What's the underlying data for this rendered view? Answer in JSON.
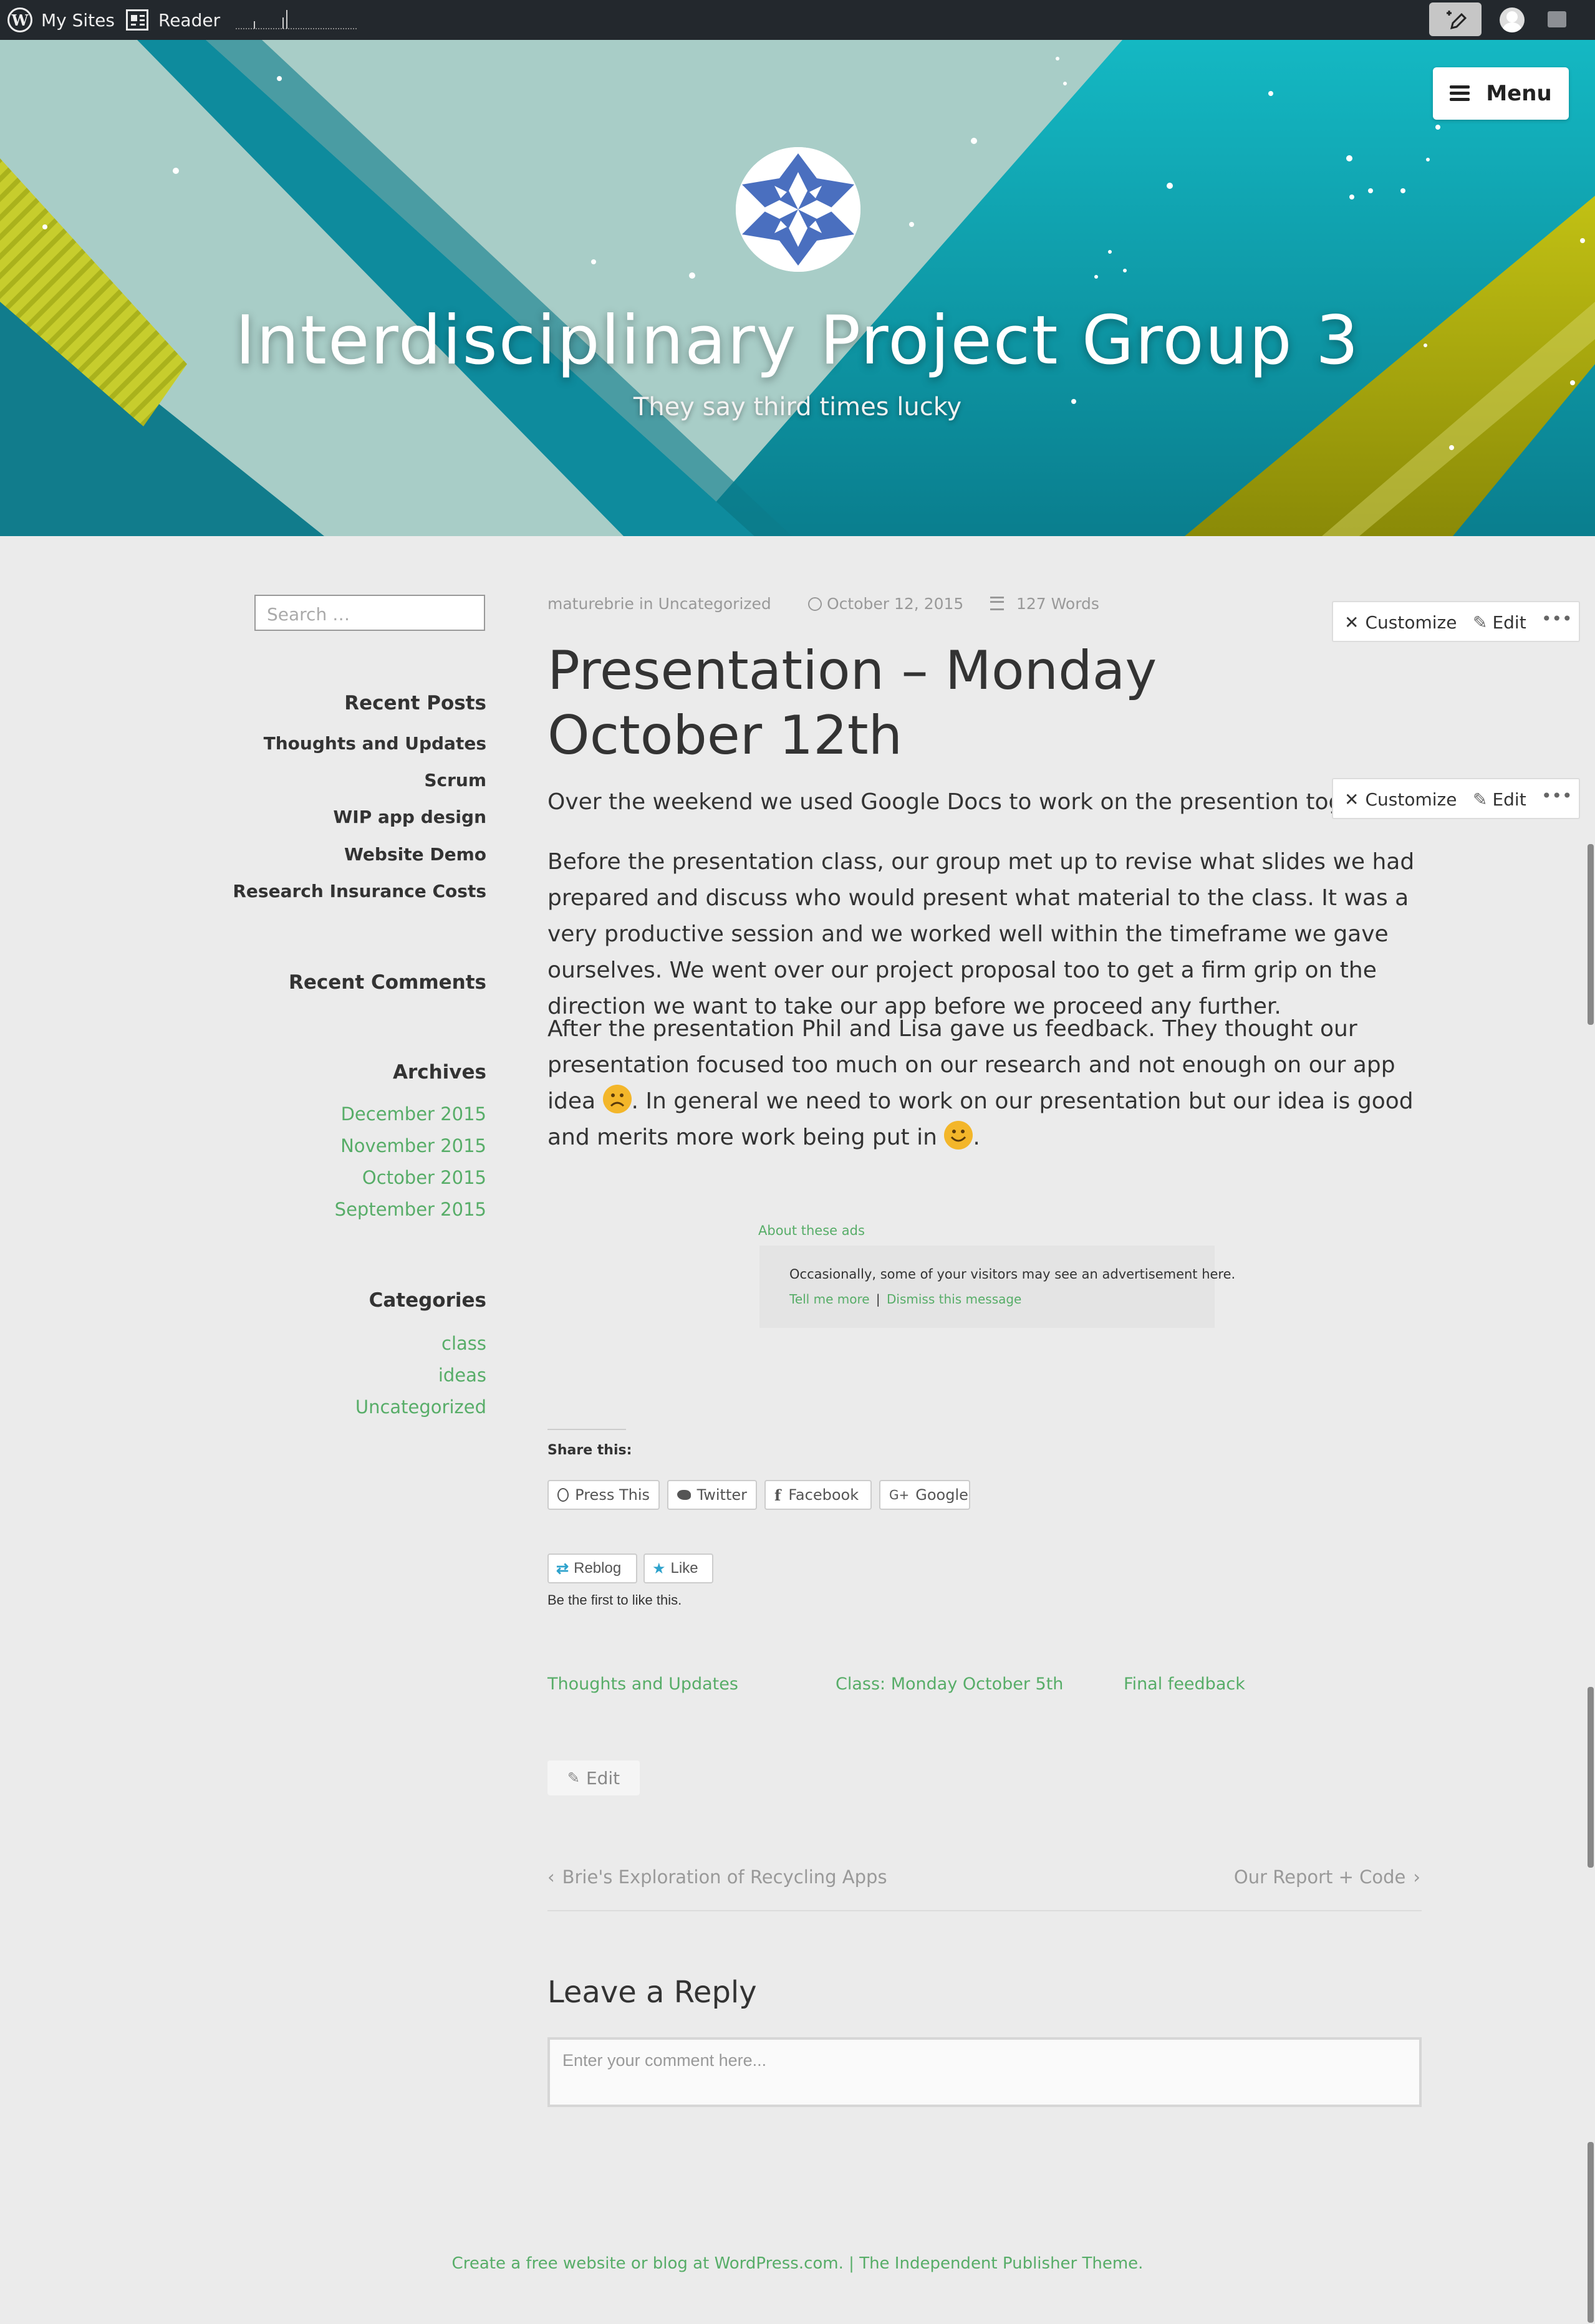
{
  "adminbar": {
    "my_sites": "My Sites",
    "reader": "Reader"
  },
  "header": {
    "title": "Interdisciplinary Project Group 3",
    "tagline": "They say third times lucky",
    "menu_label": "Menu"
  },
  "sidebar": {
    "search_placeholder": "Search …",
    "recent_posts_title": "Recent Posts",
    "recent_posts": [
      "Thoughts and Updates",
      "Scrum",
      "WIP app design",
      "Website Demo",
      "Research Insurance Costs"
    ],
    "recent_comments_title": "Recent Comments",
    "archives_title": "Archives",
    "archives": [
      "December 2015",
      "November 2015",
      "October 2015",
      "September 2015"
    ],
    "categories_title": "Categories",
    "categories": [
      "class",
      "ideas",
      "Uncategorized"
    ]
  },
  "post": {
    "author": "maturebrie",
    "in_word": "in",
    "category": "Uncategorized",
    "date": "October 12, 2015",
    "word_count": "127 Words",
    "title": "Presentation – Monday October 12th",
    "paragraph1": "Over the weekend we used Google Docs to work on the presention together.",
    "paragraph2": "Before the presentation class, our group met up to revise what slides we had prepared and discuss who would present what material to the class. It was a very productive session and we worked well within the timeframe we gave ourselves. We went over our project proposal too to get a firm grip on the direction we want to take our app before we proceed any further.",
    "paragraph3_a": "After the presentation Phil and Lisa gave us feedback. They thought our presentation focused too much on our research and not enough on our app idea ",
    "paragraph3_b": ". In general we need to work on our presentation but our idea is good and merits more work being put in ",
    "paragraph3_c": "."
  },
  "toolbar": {
    "customize": "Customize",
    "edit": "Edit",
    "more": "•••"
  },
  "ads": {
    "about": "About these ads",
    "notice": "Occasionally, some of your visitors may see an advertisement here.",
    "tell_more": "Tell me more",
    "separator": "|",
    "dismiss": "Dismiss this message"
  },
  "share": {
    "title": "Share this:",
    "press_this": "Press This",
    "twitter": "Twitter",
    "facebook": "Facebook",
    "google": "Google"
  },
  "likes": {
    "reblog": "Reblog",
    "like": "Like",
    "note": "Be the first to like this."
  },
  "related": [
    "Thoughts and Updates",
    "Class: Monday October 5th",
    "Final feedback"
  ],
  "edit_label": "Edit",
  "post_nav": {
    "prev": "Brie's Exploration of Recycling Apps",
    "next": "Our Report + Code"
  },
  "reply": {
    "title": "Leave a Reply",
    "placeholder": "Enter your comment here..."
  },
  "footer": {
    "link1": "Create a free website or blog at WordPress.com.",
    "separator": " | ",
    "link2": "The Independent Publisher Theme."
  },
  "colors": {
    "link": "#57ad68",
    "adminbar": "#23282d",
    "background": "#ebebeb"
  }
}
